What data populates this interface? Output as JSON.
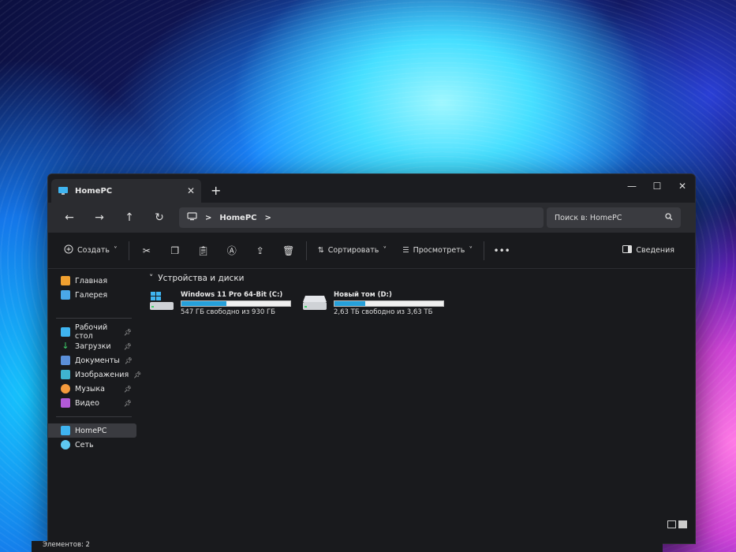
{
  "window": {
    "tab_title": "HomePC",
    "tab_close": "✕",
    "new_tab": "+",
    "controls": {
      "minimize": "—",
      "maximize": "☐",
      "close": "✕"
    }
  },
  "nav": {
    "back": "←",
    "forward": "→",
    "up": "↑",
    "refresh": "↻",
    "breadcrumb_sep": ">",
    "location": "HomePC",
    "search_placeholder": "Поиск в: HomePC"
  },
  "toolbar": {
    "create_label": "Создать",
    "sort_label": "Сортировать",
    "view_label": "Просмотреть",
    "more": "•••",
    "details_label": "Сведения"
  },
  "sidebar": {
    "top": [
      {
        "label": "Главная",
        "icon": "home-icon"
      },
      {
        "label": "Галерея",
        "icon": "gallery-icon"
      }
    ],
    "pinned": [
      {
        "label": "Рабочий стол",
        "icon": "desktop-folder-icon"
      },
      {
        "label": "Загрузки",
        "icon": "download-icon"
      },
      {
        "label": "Документы",
        "icon": "documents-icon"
      },
      {
        "label": "Изображения",
        "icon": "pictures-icon"
      },
      {
        "label": "Музыка",
        "icon": "music-icon"
      },
      {
        "label": "Видео",
        "icon": "video-icon"
      }
    ],
    "locations": [
      {
        "label": "HomePC",
        "icon": "computer-icon",
        "selected": true
      },
      {
        "label": "Сеть",
        "icon": "network-icon"
      }
    ]
  },
  "main": {
    "group_title": "Устройства и диски",
    "drives": [
      {
        "name": "Windows 11 Pro 64-Bit (C:)",
        "usage": "547 ГБ свободно из 930 ГБ",
        "used_fraction": 0.41,
        "icon": "system-drive-icon"
      },
      {
        "name": "Новый том (D:)",
        "usage": "2,63 ТБ свободно из 3,63 ТБ",
        "used_fraction": 0.28,
        "icon": "drive-icon"
      }
    ]
  },
  "status": {
    "items": "Элементов: 2"
  },
  "colors": {
    "accent": "#26a0da",
    "window_bg": "#191a1d",
    "bar_bg": "#2b2c30"
  }
}
